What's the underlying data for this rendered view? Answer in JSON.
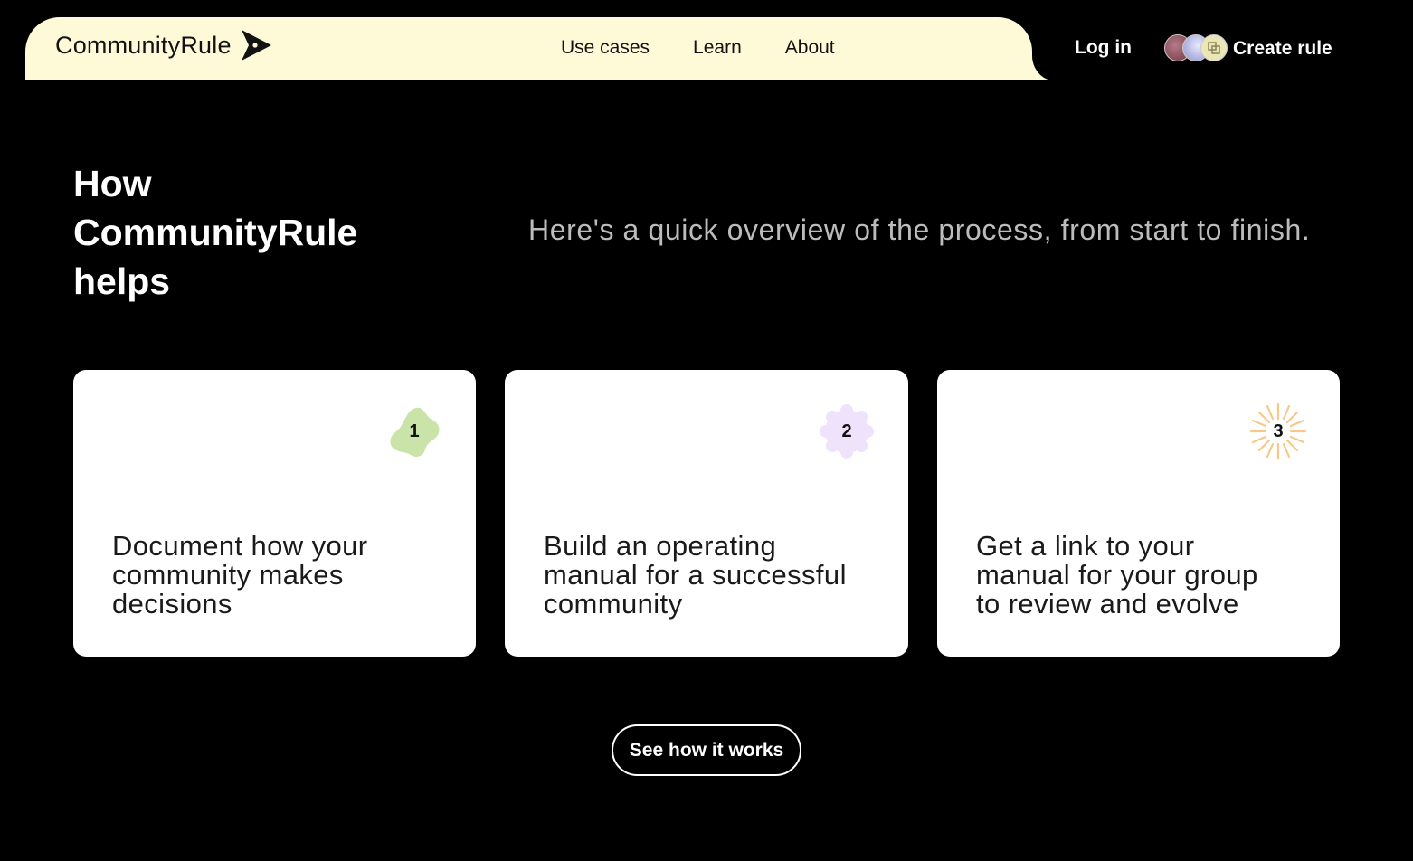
{
  "header": {
    "logo_text": "CommunityRule",
    "nav": [
      {
        "label": "Use cases"
      },
      {
        "label": "Learn"
      },
      {
        "label": "About"
      }
    ],
    "login_label": "Log in",
    "create_label": "Create rule"
  },
  "hero": {
    "title": "How CommunityRule helps",
    "subtitle": "Here's a quick overview of the process, from start to finish."
  },
  "cards": [
    {
      "number": "1",
      "text": "Document how your community makes decisions",
      "badge_color": "#c9e3a8",
      "badge_shape": "blob"
    },
    {
      "number": "2",
      "text": "Build an operating manual for a successful community",
      "badge_color": "#eee3fb",
      "badge_shape": "gear"
    },
    {
      "number": "3",
      "text": "Get a link to your manual for your group to review and evolve",
      "badge_color": "#f6c98b",
      "badge_shape": "sunburst"
    }
  ],
  "cta": {
    "label": "See how it works"
  },
  "colors": {
    "background": "#000000",
    "nav_background": "#fefad8",
    "card_background": "#ffffff",
    "subtitle": "#bcbcbc"
  }
}
